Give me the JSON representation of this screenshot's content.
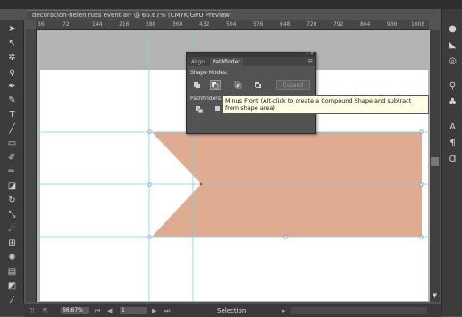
{
  "document_tab": {
    "title": "decoracion-helen russ event.ai* @ 66.67% (CMYK/GPU Preview)",
    "close": "×"
  },
  "ruler": {
    "h_ticks": [
      "36",
      "72",
      "144",
      "216",
      "288",
      "360",
      "432",
      "504",
      "576",
      "648",
      "720",
      "792",
      "864",
      "936",
      "1008"
    ]
  },
  "pathfinder_panel": {
    "tabs": [
      {
        "label": "Align",
        "active": false
      },
      {
        "label": "Pathfinder",
        "active": true
      }
    ],
    "shape_modes_label": "Shape Modes:",
    "shape_mode_buttons": [
      "unite-icon",
      "minus-front-icon",
      "intersect-icon",
      "exclude-icon"
    ],
    "expand_label": "Expand",
    "pathfinders_label": "Pathfinders:"
  },
  "tooltip": {
    "text": "Minus Front (Alt-click to create a Compound Shape and subtract from shape area)"
  },
  "status_bar": {
    "zoom": "66.67%",
    "page": "1",
    "status": "Selection"
  },
  "artwork": {
    "fill_color": "#e0ac91",
    "guide_color": "#6fd7e8"
  }
}
